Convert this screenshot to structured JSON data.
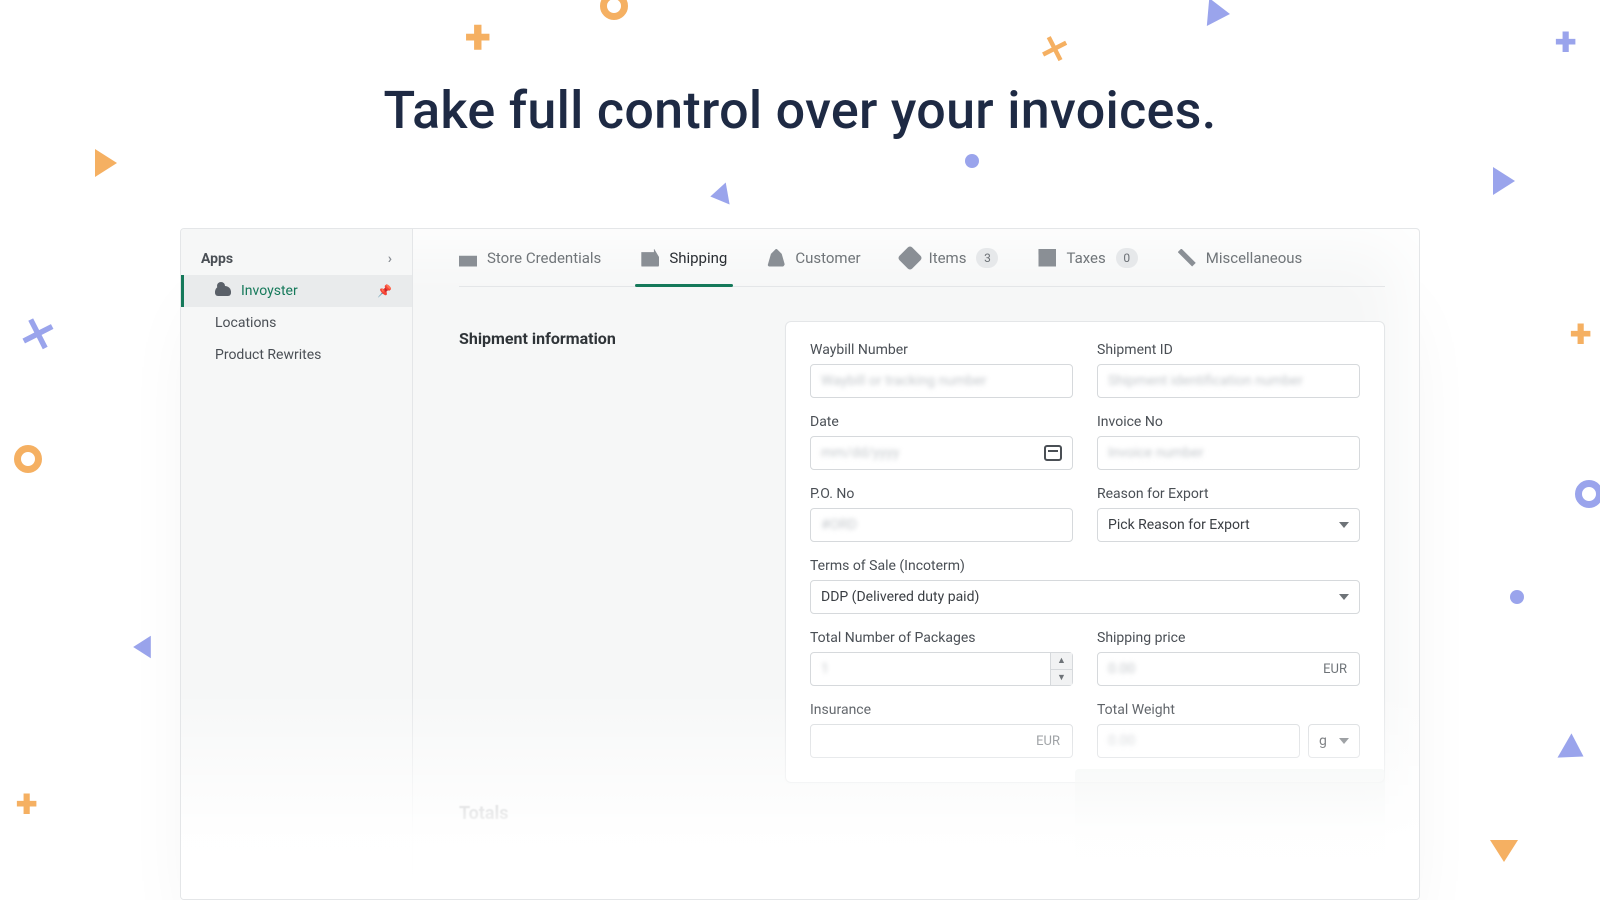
{
  "headline": "Take full control over your invoices.",
  "sidebar": {
    "heading": "Apps",
    "items": [
      {
        "label": "Invoyster",
        "active": true,
        "pinned": true
      },
      {
        "label": "Locations"
      },
      {
        "label": "Product Rewrites"
      }
    ]
  },
  "tabs": [
    {
      "id": "store",
      "label": "Store Credentials"
    },
    {
      "id": "shipping",
      "label": "Shipping",
      "active": true
    },
    {
      "id": "customer",
      "label": "Customer"
    },
    {
      "id": "items",
      "label": "Items",
      "badge": "3"
    },
    {
      "id": "taxes",
      "label": "Taxes",
      "badge": "0"
    },
    {
      "id": "misc",
      "label": "Miscellaneous"
    }
  ],
  "section": {
    "title": "Shipment information"
  },
  "form": {
    "waybill": {
      "label": "Waybill Number",
      "placeholder": "Waybill or tracking number"
    },
    "shipment_id": {
      "label": "Shipment ID",
      "placeholder": "Shipment identification number"
    },
    "date": {
      "label": "Date",
      "value": "mm/dd/yyyy"
    },
    "invoice_no": {
      "label": "Invoice No",
      "placeholder": "Invoice number"
    },
    "po_no": {
      "label": "P.O. No",
      "placeholder": "#ORD"
    },
    "reason": {
      "label": "Reason for Export",
      "value": "Pick Reason for Export"
    },
    "incoterm": {
      "label": "Terms of Sale (Incoterm)",
      "value": "DDP (Delivered duty paid)"
    },
    "packages": {
      "label": "Total Number of Packages",
      "value": "1"
    },
    "shipping_price": {
      "label": "Shipping price",
      "value": "0.00",
      "currency": "EUR"
    },
    "insurance": {
      "label": "Insurance",
      "value": "",
      "currency": "EUR"
    },
    "total_weight": {
      "label": "Total Weight",
      "value": "0.00",
      "unit": "g"
    }
  },
  "totals": {
    "title": "Totals"
  }
}
